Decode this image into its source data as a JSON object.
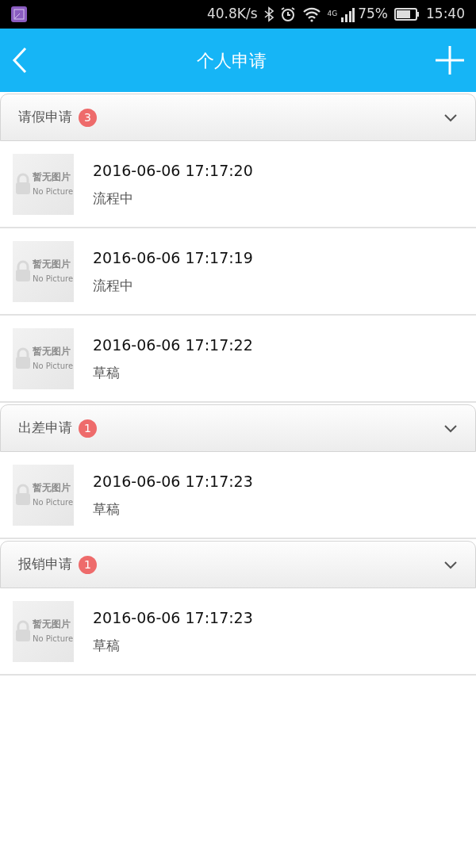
{
  "status_bar": {
    "speed": "40.8K/s",
    "network": "4G",
    "battery_text": "75%",
    "time": "15:40"
  },
  "header": {
    "title": "个人申请"
  },
  "groups": [
    {
      "title": "请假申请",
      "count": "3",
      "expanded": true,
      "items": [
        {
          "thumb_cn": "暂无图片",
          "thumb_en": "No Picture",
          "date": "2016-06-06 17:17:20",
          "status": "流程中"
        },
        {
          "thumb_cn": "暂无图片",
          "thumb_en": "No Picture",
          "date": "2016-06-06 17:17:19",
          "status": "流程中"
        },
        {
          "thumb_cn": "暂无图片",
          "thumb_en": "No Picture",
          "date": "2016-06-06 17:17:22",
          "status": "草稿"
        }
      ]
    },
    {
      "title": "出差申请",
      "count": "1",
      "expanded": true,
      "items": [
        {
          "thumb_cn": "暂无图片",
          "thumb_en": "No Picture",
          "date": "2016-06-06 17:17:23",
          "status": "草稿"
        }
      ]
    },
    {
      "title": "报销申请",
      "count": "1",
      "expanded": true,
      "items": [
        {
          "thumb_cn": "暂无图片",
          "thumb_en": "No Picture",
          "date": "2016-06-06 17:17:23",
          "status": "草稿"
        }
      ]
    }
  ]
}
